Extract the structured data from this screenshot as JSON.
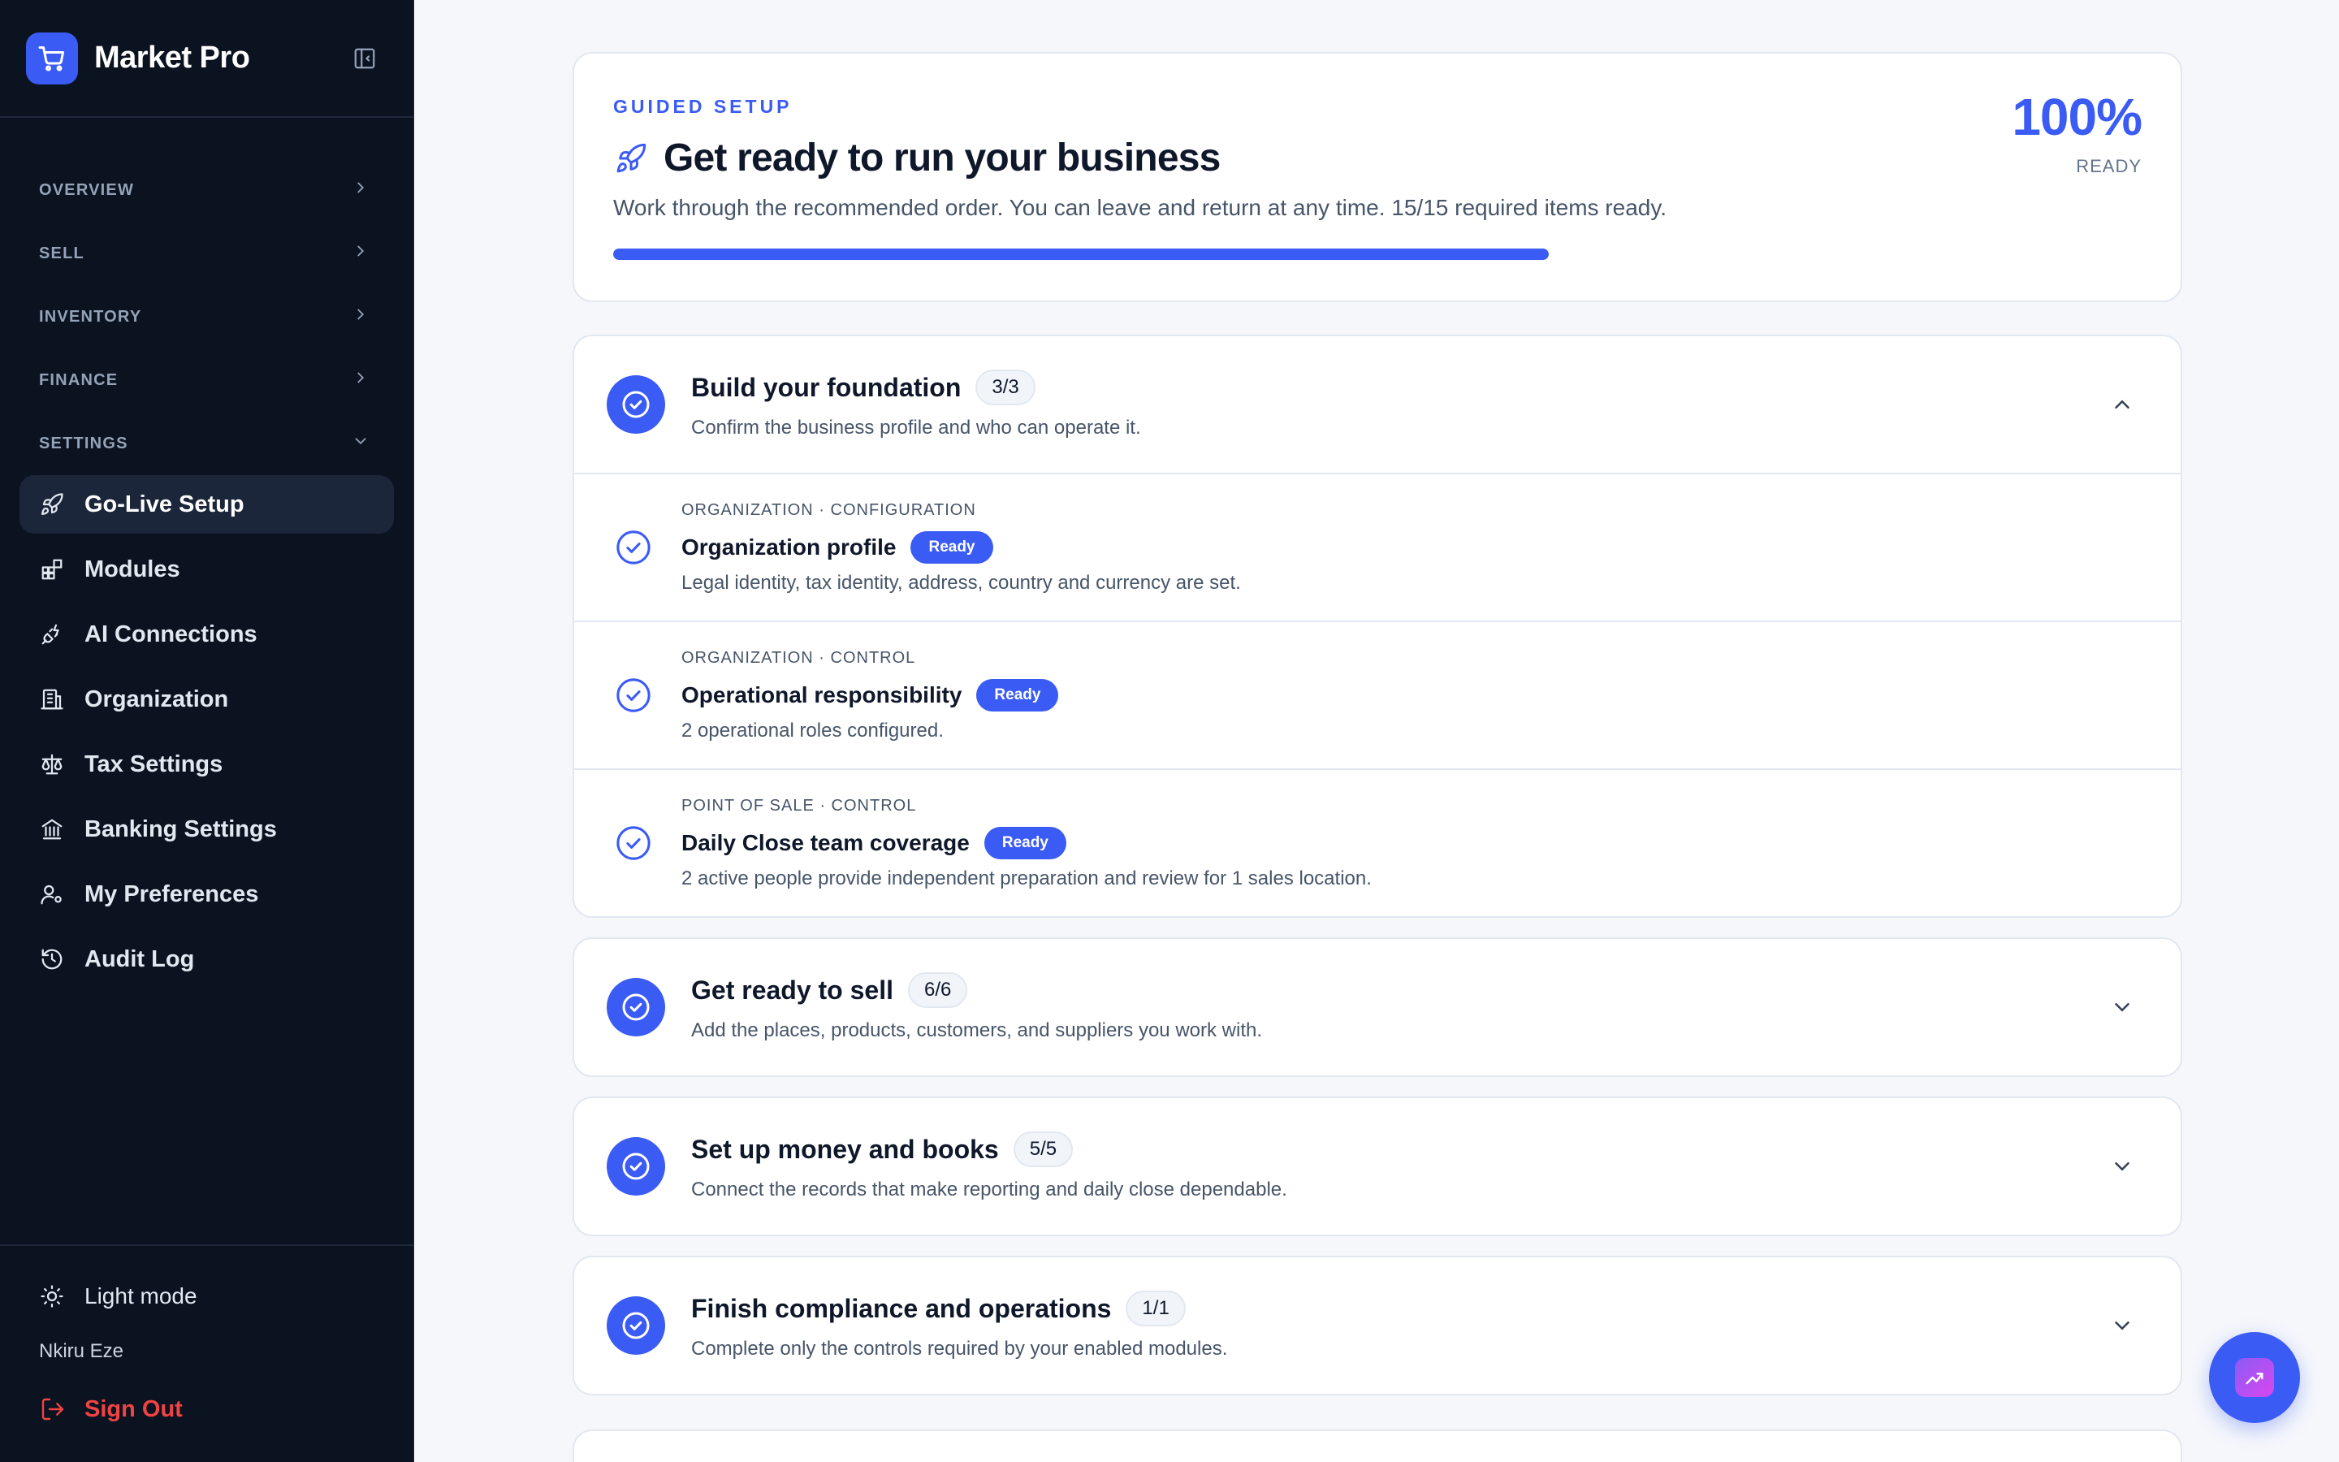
{
  "app": {
    "name": "Market Pro"
  },
  "sidebar": {
    "groups": [
      {
        "label": "OVERVIEW",
        "icon": "chevron-right-icon"
      },
      {
        "label": "SELL",
        "icon": "chevron-right-icon"
      },
      {
        "label": "INVENTORY",
        "icon": "chevron-right-icon"
      },
      {
        "label": "FINANCE",
        "icon": "chevron-right-icon"
      },
      {
        "label": "SETTINGS",
        "icon": "chevron-down-icon"
      }
    ],
    "items": [
      {
        "label": "Go-Live Setup",
        "icon": "rocket-icon",
        "active": true
      },
      {
        "label": "Modules",
        "icon": "modules-icon"
      },
      {
        "label": "AI Connections",
        "icon": "plug-icon"
      },
      {
        "label": "Organization",
        "icon": "building-icon"
      },
      {
        "label": "Tax Settings",
        "icon": "scale-icon"
      },
      {
        "label": "Banking Settings",
        "icon": "bank-icon"
      },
      {
        "label": "My Preferences",
        "icon": "user-settings-icon"
      },
      {
        "label": "Audit Log",
        "icon": "history-icon"
      }
    ],
    "theme_toggle": "Light mode",
    "user_name": "Nkiru Eze",
    "sign_out": "Sign Out"
  },
  "hero": {
    "eyebrow": "GUIDED SETUP",
    "title": "Get ready to run your business",
    "description": "Work through the recommended order. You can leave and return at any time. 15/15 required items ready.",
    "percent": "100%",
    "percent_label": "READY",
    "progress": 1.0
  },
  "sections": [
    {
      "title": "Build your foundation",
      "count": "3/3",
      "description": "Confirm the business profile and who can operate it.",
      "expanded": true,
      "tasks": [
        {
          "meta": "ORGANIZATION · CONFIGURATION",
          "title": "Organization profile",
          "badge": "Ready",
          "description": "Legal identity, tax identity, address, country and currency are set."
        },
        {
          "meta": "ORGANIZATION · CONTROL",
          "title": "Operational responsibility",
          "badge": "Ready",
          "description": "2 operational roles configured."
        },
        {
          "meta": "POINT OF SALE · CONTROL",
          "title": "Daily Close team coverage",
          "badge": "Ready",
          "description": "2 active people provide independent preparation and review for 1 sales location."
        }
      ]
    },
    {
      "title": "Get ready to sell",
      "count": "6/6",
      "description": "Add the places, products, customers, and suppliers you work with.",
      "expanded": false
    },
    {
      "title": "Set up money and books",
      "count": "5/5",
      "description": "Connect the records that make reporting and daily close dependable.",
      "expanded": false
    },
    {
      "title": "Finish compliance and operations",
      "count": "1/1",
      "description": "Complete only the controls required by your enabled modules.",
      "expanded": false
    }
  ],
  "colors": {
    "accent": "#3b5bf5",
    "sidebar_bg": "#0b1220",
    "danger": "#ef4444"
  }
}
